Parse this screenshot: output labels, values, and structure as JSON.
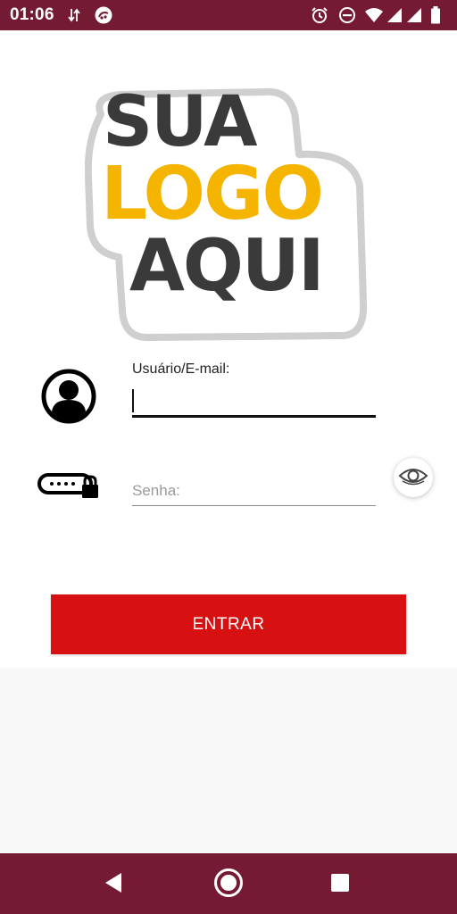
{
  "status_bar": {
    "time": "01:06",
    "background": "#741b33",
    "icons": [
      "data-transfer-icon",
      "app-notification-icon",
      "alarm-icon",
      "do-not-disturb-icon",
      "wifi-icon",
      "signal-icon",
      "signal-icon-2",
      "battery-icon"
    ]
  },
  "logo": {
    "line1": "SUA",
    "line2": "LOGO",
    "line3": "AQUI",
    "primary_color": "#3a3a3a",
    "accent_color": "#f4b400"
  },
  "login": {
    "user_label": "Usuário/E-mail:",
    "user_value": "",
    "password_placeholder": "Senha:",
    "password_value": "",
    "enter_label": "ENTRAR",
    "enter_color": "#d71012"
  },
  "nav_bar": {
    "background": "#741b33",
    "buttons": [
      "back-icon",
      "home-icon",
      "recents-icon"
    ]
  }
}
